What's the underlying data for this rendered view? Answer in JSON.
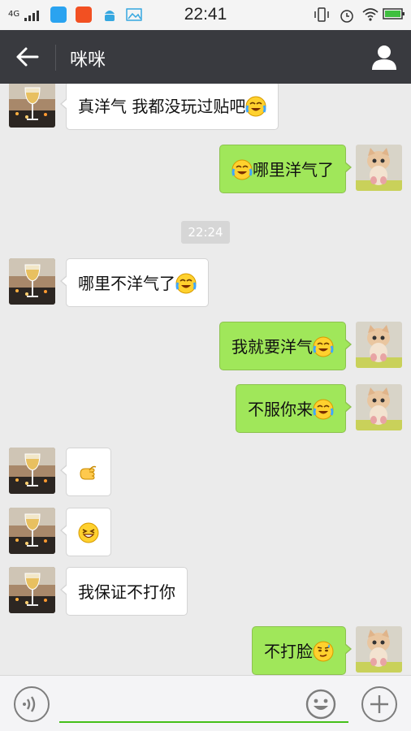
{
  "status_bar": {
    "network": "4G",
    "time": "22:41",
    "app_icons": [
      "vivo-store-icon",
      "sogou-icon",
      "android-icon",
      "gallery-icon"
    ],
    "right_icons": [
      "vibrate-icon",
      "alarm-icon",
      "wifi-icon",
      "battery-icon"
    ]
  },
  "header": {
    "title": "咪咪",
    "back_icon": "arrow-left-icon",
    "profile_icon": "person-icon",
    "background": "#393a3f"
  },
  "timestamp": "22:24",
  "messages": [
    {
      "side": "left",
      "text": "真洋气     我都没玩过贴吧",
      "emoji": "tears-of-joy"
    },
    {
      "side": "right",
      "text_before": "",
      "text": "哪里洋气了",
      "emoji_first": "tears-of-joy"
    },
    {
      "side": "left",
      "text": "哪里不洋气了",
      "emoji": "tears-of-joy"
    },
    {
      "side": "right",
      "text": "我就要洋气",
      "emoji": "tears-of-joy"
    },
    {
      "side": "right",
      "text": "不服你来",
      "emoji": "tears-of-joy"
    },
    {
      "side": "left",
      "text": "",
      "emoji": "come-here-hand"
    },
    {
      "side": "left",
      "text": "",
      "emoji": "grin-squint"
    },
    {
      "side": "left",
      "text": "我保证不打你",
      "emoji": ""
    },
    {
      "side": "right",
      "text": "不打脸",
      "emoji": "sweat-smirk"
    }
  ],
  "input_bar": {
    "voice_icon": "voice-icon",
    "input_value": "",
    "emoji_icon": "smiley-icon",
    "plus_icon": "plus-icon",
    "accent": "#45c01a"
  },
  "colors": {
    "my_bubble": "#a0e75a",
    "their_bubble": "#ffffff",
    "chat_bg": "#ebebeb"
  }
}
